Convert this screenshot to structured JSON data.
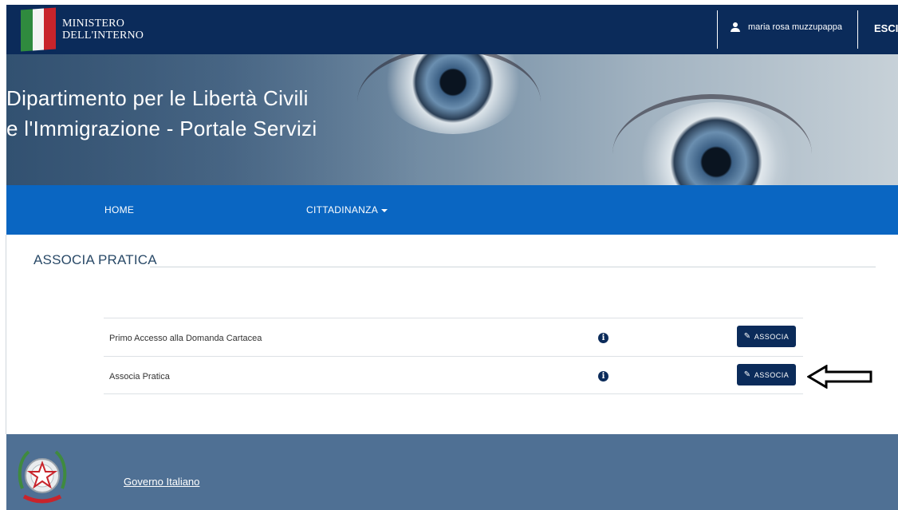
{
  "header": {
    "ministry_line1": "MINISTERO",
    "ministry_line2": "DELL'INTERNO",
    "user_icon": "user-icon",
    "user_name": "maria rosa muzzupappa",
    "logout_label": "ESCI"
  },
  "hero": {
    "title_line1": "Dipartimento per le Libertà Civili",
    "title_line2": "e l'Immigrazione - Portale Servizi"
  },
  "nav": {
    "items": [
      {
        "label": "HOME"
      },
      {
        "label": "CITTADINANZA",
        "has_dropdown": true
      }
    ]
  },
  "main": {
    "section_title": "ASSOCIA PRATICA",
    "rows": [
      {
        "label": "Primo Accesso alla Domanda Cartacea",
        "info_icon": "info-icon",
        "button_label": "ASSOCIA",
        "button_icon": "pencil-icon"
      },
      {
        "label": "Associa Pratica",
        "info_icon": "info-icon",
        "button_label": "ASSOCIA",
        "button_icon": "pencil-icon"
      }
    ]
  },
  "footer": {
    "emblem_icon": "italian-emblem-icon",
    "link_label": "Governo Italiano"
  },
  "colors": {
    "topbar": "#0b2b5a",
    "nav": "#0a66c2",
    "footer": "#4f7094",
    "button": "#0b2b5a"
  }
}
